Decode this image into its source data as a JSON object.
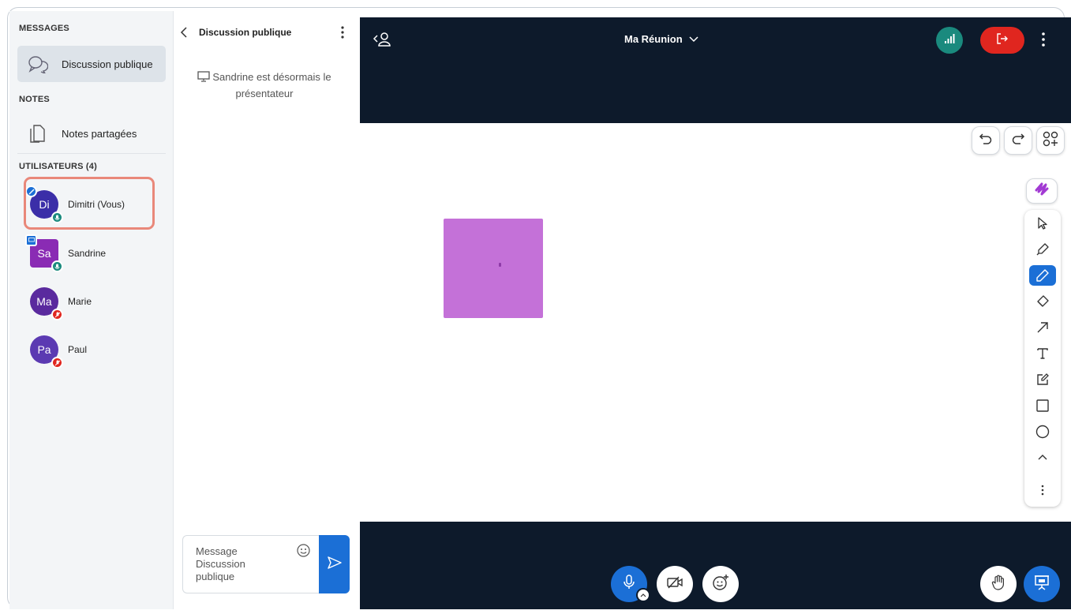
{
  "sidebar": {
    "messages_title": "MESSAGES",
    "public_chat": "Discussion publique",
    "notes_title": "NOTES",
    "shared_notes": "Notes partagées",
    "users_title": "UTILISATEURS (4)",
    "users": [
      {
        "initials": "Di",
        "name": "Dimitri (Vous)",
        "color": "#3b2ea8"
      },
      {
        "initials": "Sa",
        "name": "Sandrine",
        "color": "#8a2bb4"
      },
      {
        "initials": "Ma",
        "name": "Marie",
        "color": "#5a2a9e"
      },
      {
        "initials": "Pa",
        "name": "Paul",
        "color": "#5b3ab2"
      }
    ]
  },
  "chat": {
    "title": "Discussion publique",
    "system_message": "Sandrine est désormais le présentateur",
    "input_placeholder": "Message Discussion publique"
  },
  "meeting": {
    "title": "Ma Réunion"
  },
  "colors": {
    "accent": "#1b6fd6",
    "leave": "#e0261f",
    "connection": "#1a8a7e",
    "topbar": "#0d1a2b",
    "shape": "#c471d8",
    "highlight": "#e9887a"
  },
  "icons": {
    "toolbar": [
      "select-icon",
      "highlighter-icon",
      "pencil-icon",
      "eraser-icon",
      "arrow-icon",
      "text-icon",
      "note-icon",
      "rectangle-icon",
      "ellipse-icon",
      "collapse-icon",
      "more-icon"
    ]
  }
}
